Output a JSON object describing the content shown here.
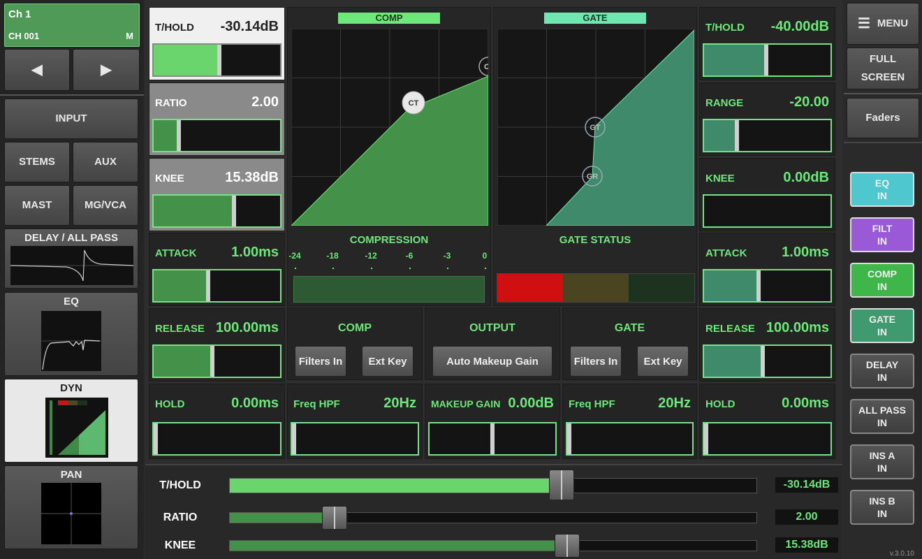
{
  "channel": {
    "name": "Ch 1",
    "id": "CH 001",
    "mode": "M"
  },
  "nav": {
    "input": "INPUT",
    "stems": "STEMS",
    "aux": "AUX",
    "mast": "MAST",
    "mgvca": "MG/VCA",
    "delay": "DELAY / ALL PASS",
    "eq": "EQ",
    "dyn": "DYN",
    "pan": "PAN"
  },
  "comp": {
    "thold": {
      "label": "T/HOLD",
      "value": "-30.14dB",
      "level": 0.52
    },
    "ratio": {
      "label": "RATIO",
      "value": "2.00",
      "level": 0.19
    },
    "knee": {
      "label": "KNEE",
      "value": "15.38dB",
      "level": 0.64
    },
    "attack": {
      "label": "ATTACK",
      "value": "1.00ms",
      "level": 0.43
    },
    "release": {
      "label": "RELEASE",
      "value": "100.00ms",
      "level": 0.46
    },
    "hold": {
      "label": "HOLD",
      "value": "0.00ms",
      "level": 0.0
    },
    "graph_title": "COMP",
    "graph_point": "CT",
    "graph_edge": "C",
    "meter_title": "COMPRESSION",
    "meter_scale": [
      "-24",
      "-18",
      "-12",
      "-6",
      "-3",
      "0"
    ]
  },
  "gate": {
    "thold": {
      "label": "T/HOLD",
      "value": "-40.00dB",
      "level": 0.49
    },
    "range": {
      "label": "RANGE",
      "value": "-20.00",
      "level": 0.25
    },
    "knee": {
      "label": "KNEE",
      "value": "0.00dB",
      "level": 0.0
    },
    "attack": {
      "label": "ATTACK",
      "value": "1.00ms",
      "level": 0.43
    },
    "release": {
      "label": "RELEASE",
      "value": "100.00ms",
      "level": 0.46
    },
    "hold": {
      "label": "HOLD",
      "value": "0.00ms",
      "level": 0.0
    },
    "graph_title": "GATE",
    "point_gt": "GT",
    "point_gr": "GR",
    "status_title": "GATE STATUS"
  },
  "bottom": {
    "comp_title": "COMP",
    "output_title": "OUTPUT",
    "gate_title": "GATE",
    "filters_in": "Filters In",
    "ext_key": "Ext Key",
    "auto_makeup": "Auto Makeup Gain",
    "comp_hpf": {
      "label": "Freq HPF",
      "value": "20Hz",
      "level": 0.0
    },
    "makeup": {
      "label": "MAKEUP GAIN",
      "value": "0.00dB",
      "level": 0.5
    },
    "gate_hpf": {
      "label": "Freq HPF",
      "value": "20Hz",
      "level": 0.0
    }
  },
  "sliders": [
    {
      "label": "T/HOLD",
      "value": "-30.14dB",
      "level": 0.63
    },
    {
      "label": "RATIO",
      "value": "2.00",
      "level": 0.2
    },
    {
      "label": "KNEE",
      "value": "15.38dB",
      "level": 0.64
    }
  ],
  "right": {
    "menu": "MENU",
    "fullscreen": "FULL SCREEN",
    "faders": "Faders"
  },
  "switches": [
    {
      "name": "EQ",
      "state": "IN",
      "color": "#4fc7cf"
    },
    {
      "name": "FILT",
      "state": "IN",
      "color": "#9a5ad8"
    },
    {
      "name": "COMP",
      "state": "IN",
      "color": "#3fb64a"
    },
    {
      "name": "GATE",
      "state": "IN",
      "color": "#3f9a70"
    },
    {
      "name": "DELAY",
      "state": "IN",
      "color": ""
    },
    {
      "name": "ALL PASS",
      "state": "IN",
      "color": ""
    },
    {
      "name": "INS A",
      "state": "IN",
      "color": ""
    },
    {
      "name": "INS B",
      "state": "IN",
      "color": ""
    }
  ],
  "version": "v.3.0.10"
}
